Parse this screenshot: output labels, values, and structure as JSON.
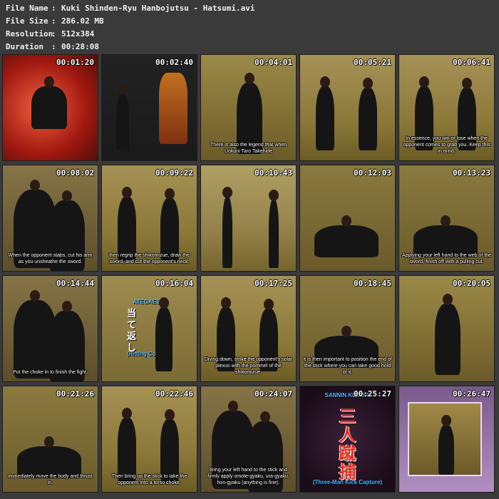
{
  "header": {
    "rows": [
      {
        "key": "File Name",
        "value": "Kuki Shinden-Ryu Hanbojutsu - Hatsumi.avi"
      },
      {
        "key": "File Size",
        "value": "286.02 MB"
      },
      {
        "key": "Resolution",
        "value": "512x384"
      },
      {
        "key": "Duration",
        "value": "00:28:08"
      }
    ],
    "separator": ":"
  },
  "thumbnails": [
    {
      "time": "00:01:20",
      "subtitle": "",
      "scene": "title-art"
    },
    {
      "time": "00:02:40",
      "subtitle": "",
      "scene": "armor"
    },
    {
      "time": "00:04:01",
      "subtitle": "There is also the legend that when Uokuni Taro Takehide",
      "scene": "single"
    },
    {
      "time": "00:05:21",
      "subtitle": "",
      "scene": "pair"
    },
    {
      "time": "00:06:41",
      "subtitle": "In essence, you win or lose when the opponent comes to grab you. Keep this in mind.",
      "scene": "pair"
    },
    {
      "time": "00:08:02",
      "subtitle": "When the opponent stabs, cut his arm as you unsheathe the sword.",
      "scene": "closeup"
    },
    {
      "time": "00:09:22",
      "subtitle": "then regrip the shikomizue, draw the sword, and cut the opponent's neck.",
      "scene": "pair"
    },
    {
      "time": "00:10:43",
      "subtitle": "",
      "scene": "pair-far"
    },
    {
      "time": "00:12:03",
      "subtitle": "",
      "scene": "ground"
    },
    {
      "time": "00:13:23",
      "subtitle": "Applying your left hand to the web of the sword, finish off with a pulling cut.",
      "scene": "ground"
    },
    {
      "time": "00:14:44",
      "subtitle": "Put the choke in to finish the fight.",
      "scene": "closeup"
    },
    {
      "time": "00:16:04",
      "subtitle": "",
      "scene": "ategaeshi",
      "label_top": "ATEGAESHI",
      "kanji": [
        "当",
        "て",
        "返",
        "し"
      ],
      "label_bottom": "(Hitting Counter)"
    },
    {
      "time": "00:17:25",
      "subtitle": "Diving down, strike the opponent's solar plexus with the pommel of the shikomizue.",
      "scene": "pair"
    },
    {
      "time": "00:18:45",
      "subtitle": "It is then important to position the end of the stick where you can take good hold of it.",
      "scene": "ground"
    },
    {
      "time": "00:20:05",
      "subtitle": "",
      "scene": "single"
    },
    {
      "time": "00:21:26",
      "subtitle": "immediately move the body and thrust in.",
      "scene": "ground"
    },
    {
      "time": "00:22:46",
      "subtitle": "Then bring up the stick to take the opponent into a torso choke.",
      "scene": "pair"
    },
    {
      "time": "00:24:07",
      "subtitle": "bring your left hand to the stick and firmly apply omote-gyaku, ura-gyaku, hon-gyaku (anything is fine).",
      "scene": "closeup"
    },
    {
      "time": "00:25:27",
      "subtitle": "",
      "scene": "sannin",
      "label_top": "SANNIN KEDORI",
      "kanji": [
        "三",
        "人",
        "蹴",
        "捕"
      ],
      "label_bottom": "(Three-Man Kick Capture)"
    },
    {
      "time": "00:26:47",
      "subtitle": "",
      "scene": "framed"
    }
  ]
}
